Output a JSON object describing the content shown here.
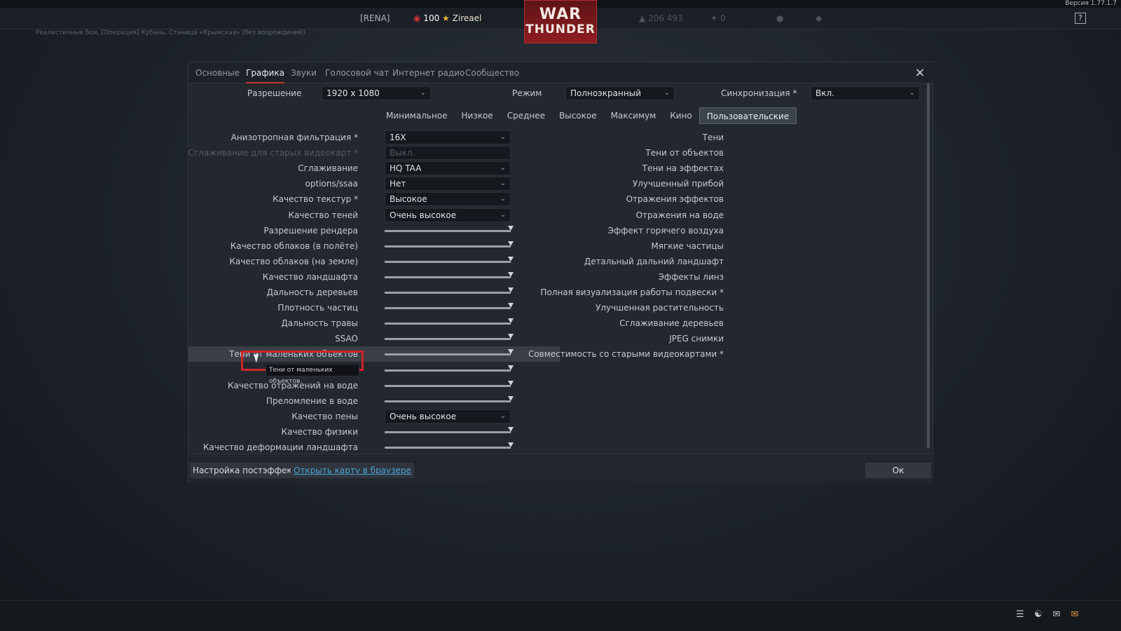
{
  "top": {
    "version": "Версия 1.77.1.7",
    "squad": "[RENA]",
    "level": "100",
    "username": "Zireael",
    "silver_lions": "206 493",
    "golden_eagles": "0",
    "logo_line1": "WAR",
    "logo_line2": "THUNDER",
    "help": "?",
    "battle_info": "Реалистичные бои, [Операция] Кубань. Станица «Крымская» (без возрождений)"
  },
  "tabs": [
    "Основные",
    "Графика",
    "Звуки",
    "Голосовой чат",
    "Интернет радио",
    "Сообщество"
  ],
  "close_icon": "×",
  "resolution": {
    "label": "Разрешение",
    "value": "1920 x 1080"
  },
  "mode": {
    "label": "Режим",
    "value": "Полноэкранный"
  },
  "vsync": {
    "label": "Синхронизация *",
    "value": "Вкл."
  },
  "presets": [
    "Минимальное",
    "Низкое",
    "Среднее",
    "Высокое",
    "Максимум",
    "Кино",
    "Пользовательские"
  ],
  "left": [
    {
      "name": "Анизотропная фильтрация *",
      "type": "dd",
      "value": "16X"
    },
    {
      "name": "Сглаживание для старых видеокарт *",
      "type": "dd",
      "value": "Выкл."
    },
    {
      "name": "Сглаживание",
      "type": "dd",
      "value": "HQ TAA"
    },
    {
      "name": "options/ssaa",
      "type": "dd",
      "value": "Нет"
    },
    {
      "name": "Качество текстур *",
      "type": "dd",
      "value": "Высокое"
    },
    {
      "name": "Качество теней",
      "type": "dd",
      "value": "Очень высокое"
    },
    {
      "name": "Разрешение рендера",
      "type": "slider",
      "value": 1.0
    },
    {
      "name": "Качество облаков (в полёте)",
      "type": "slider",
      "value": 1.0
    },
    {
      "name": "Качество облаков (на земле)",
      "type": "slider",
      "value": 1.0
    },
    {
      "name": "Качество ландшафта",
      "type": "slider",
      "value": 1.0
    },
    {
      "name": "Дальность деревьев",
      "type": "slider",
      "value": 1.0
    },
    {
      "name": "Плотность частиц",
      "type": "slider",
      "value": 1.0
    },
    {
      "name": "Дальность травы",
      "type": "slider",
      "value": 1.0
    },
    {
      "name": "SSAO",
      "type": "slider",
      "value": 1.0
    },
    {
      "name": "Тени от маленьких объектов",
      "type": "slider",
      "value": 1.0
    },
    {
      "name": "",
      "type": "slider",
      "value": 1.0
    },
    {
      "name": "Качество отражений на воде",
      "type": "slider",
      "value": 1.0
    },
    {
      "name": "Преломление в воде",
      "type": "slider",
      "value": 1.0
    },
    {
      "name": "Качество пены",
      "type": "dd",
      "value": "Очень высокое"
    },
    {
      "name": "Качество физики",
      "type": "slider",
      "value": 1.0
    },
    {
      "name": "Качество деформации ландшафта",
      "type": "slider",
      "value": 1.0
    }
  ],
  "right": [
    {
      "name": "Тени",
      "value": "Да",
      "on": true
    },
    {
      "name": "Тени от объектов",
      "value": "Да",
      "on": true
    },
    {
      "name": "Тени на эффектах",
      "value": "Да",
      "on": true
    },
    {
      "name": "Улучшенный прибой",
      "value": "Да",
      "on": true
    },
    {
      "name": "Отражения эффектов",
      "value": "Да",
      "on": true
    },
    {
      "name": "Отражения на воде",
      "value": "Да",
      "on": true
    },
    {
      "name": "Эффект горячего воздуха",
      "value": "Да",
      "on": true
    },
    {
      "name": "Мягкие частицы",
      "value": "Да",
      "on": true
    },
    {
      "name": "Детальный дальний ландшафт",
      "value": "Да",
      "on": true
    },
    {
      "name": "Эффекты линз",
      "value": "Да",
      "on": true
    },
    {
      "name": "Полная визуализация работы подвески *",
      "value": "Да",
      "on": true
    },
    {
      "name": "Улучшенная растительность",
      "value": "Да",
      "on": true
    },
    {
      "name": "Сглаживание деревьев",
      "value": "Да",
      "on": true
    },
    {
      "name": "JPEG снимки",
      "value": "Да",
      "on": true
    },
    {
      "name": "Совместимость со старыми видеокартами *",
      "value": "Нет",
      "on": false
    }
  ],
  "tooltip": "Тени от маленьких объектов.",
  "footer": {
    "postfx": "Настройка постэффектов",
    "map": "Открыть карту в браузере",
    "ok": "Ок"
  },
  "bottom_icons": [
    "list-icon",
    "squad-icon",
    "chat-icon",
    "mail-icon"
  ]
}
